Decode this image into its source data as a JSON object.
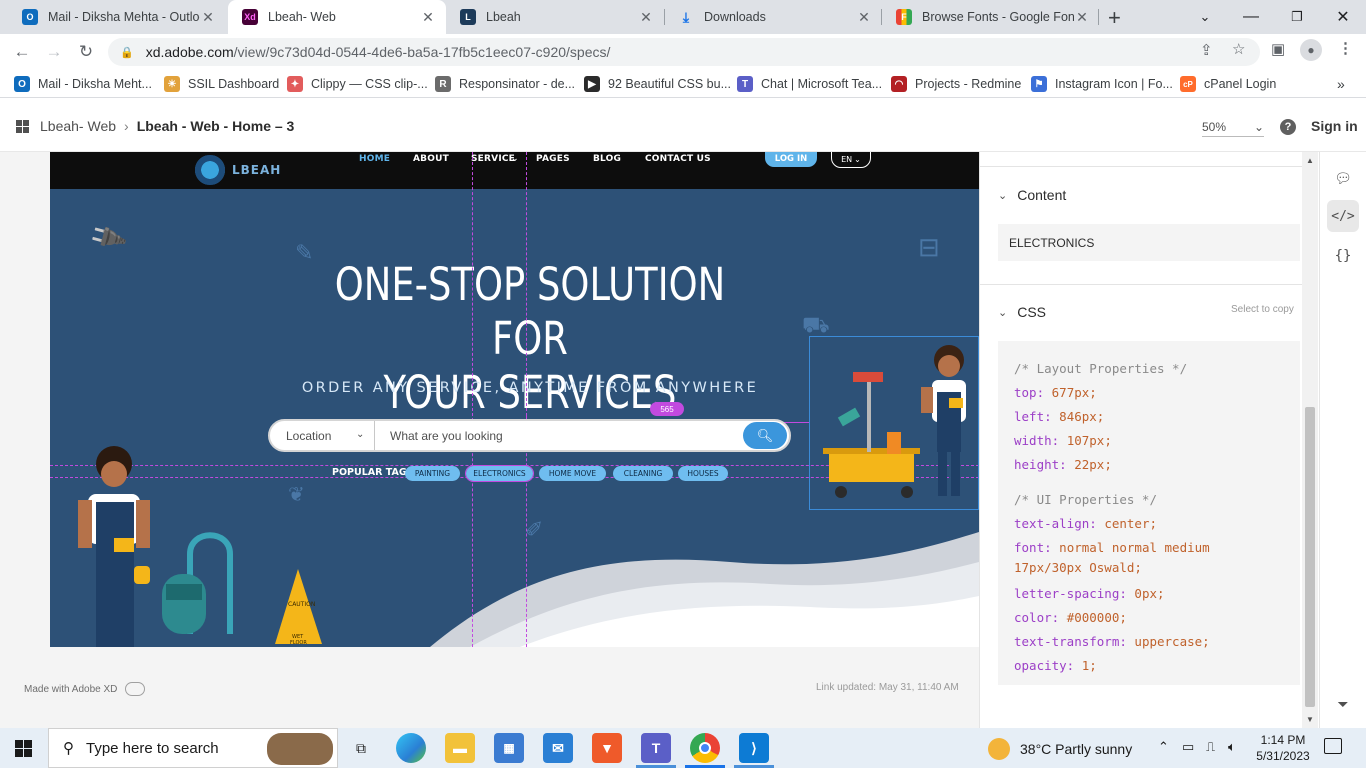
{
  "browser": {
    "tabs": [
      {
        "title": "Mail - Diksha Mehta - Outlook",
        "icon": "outlook-icon",
        "color": "#0f6cbd",
        "glyph": "O"
      },
      {
        "title": "Lbeah- Web",
        "icon": "adobe-xd-icon",
        "color": "#470137",
        "glyph": "Xd"
      },
      {
        "title": "Lbeah",
        "icon": "lbeah-icon",
        "color": "#1d3b5a",
        "glyph": "L"
      },
      {
        "title": "Downloads",
        "icon": "download-icon",
        "color": "#1a73e8",
        "glyph": "↓"
      },
      {
        "title": "Browse Fonts - Google Fonts",
        "icon": "google-fonts-icon",
        "color": "#34a853",
        "glyph": "F"
      }
    ],
    "url_host": "xd.adobe.com",
    "url_path": "/view/9c73d04d-0544-4de6-ba5a-17fb5c1eec07-c920/specs/",
    "bookmarks": [
      {
        "label": "Mail - Diksha Meht...",
        "color": "#0f6cbd",
        "glyph": "O"
      },
      {
        "label": "SSIL Dashboard",
        "color": "#e2a23b",
        "glyph": "☀"
      },
      {
        "label": "Clippy — CSS clip-...",
        "color": "#e25c5c",
        "glyph": "✦"
      },
      {
        "label": "Responsinator - de...",
        "color": "#6b6b6b",
        "glyph": "R"
      },
      {
        "label": "92 Beautiful CSS bu...",
        "color": "#2b2b2b",
        "glyph": "▶"
      },
      {
        "label": "Chat | Microsoft Tea...",
        "color": "#5b5fc7",
        "glyph": "T"
      },
      {
        "label": "Projects - Redmine",
        "color": "#b32024",
        "glyph": "◠"
      },
      {
        "label": "Instagram Icon | Fo...",
        "color": "#3b6fd8",
        "glyph": "⚑"
      },
      {
        "label": "cPanel Login",
        "color": "#ff6c2c",
        "glyph": "cP"
      }
    ]
  },
  "xd": {
    "breadcrumb_root": "Lbeah- Web",
    "breadcrumb_current": "Lbeah - Web - Home – 3",
    "zoom": "50%",
    "sign_in": "Sign in",
    "made_with": "Made with Adobe XD",
    "link_updated": "Link updated: May 31, 11:40 AM"
  },
  "site": {
    "logo": "LBEAH",
    "nav": [
      "HOME",
      "ABOUT",
      "SERVICE",
      "PAGES",
      "BLOG",
      "CONTACT US"
    ],
    "login": "LOG IN",
    "lang": "EN",
    "hero_line1": "ONE-STOP SOLUTION FOR",
    "hero_line2": "YOUR SERVICES",
    "hero_sub": "ORDER ANY SERVICE, ANYTIME FROM ANYWHERE",
    "location_label": "Location",
    "search_placeholder": "What are you looking",
    "tags_label": "POPULAR TAGS:",
    "tags": [
      "PAINTING",
      "ELECTRONICS",
      "HOME MOVE",
      "CLEANING",
      "HOUSES"
    ],
    "measure": "565"
  },
  "inspector": {
    "content_heading": "Content",
    "content_value": "ELECTRONICS",
    "css_heading": "CSS",
    "copy_hint": "Select to copy",
    "layout_comment": "/* Layout Properties */",
    "layout": [
      {
        "prop": "top:",
        "val": "677px;"
      },
      {
        "prop": "left:",
        "val": "846px;"
      },
      {
        "prop": "width:",
        "val": "107px;"
      },
      {
        "prop": "height:",
        "val": "22px;"
      }
    ],
    "ui_comment": "/* UI Properties */",
    "ui": [
      {
        "prop": "text-align:",
        "val": "center;"
      },
      {
        "prop": "font:",
        "val": "normal normal medium"
      },
      {
        "prop": "",
        "val": "17px/30px Oswald;"
      },
      {
        "prop": "letter-spacing:",
        "val": "0px;"
      },
      {
        "prop": "color:",
        "val": "#000000;"
      },
      {
        "prop": "text-transform:",
        "val": "uppercase;"
      },
      {
        "prop": "opacity:",
        "val": "1;"
      }
    ]
  },
  "taskbar": {
    "search_placeholder": "Type here to search",
    "weather": "38°C  Partly sunny",
    "time": "1:14 PM",
    "date": "5/31/2023"
  }
}
